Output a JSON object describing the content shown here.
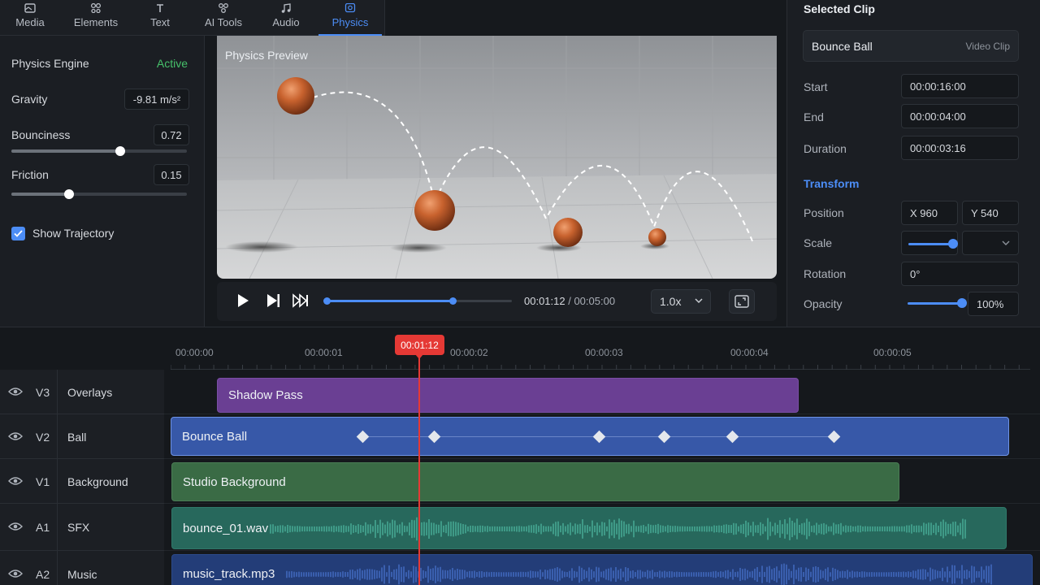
{
  "tabs": [
    {
      "label": "Media",
      "icon": "media-icon"
    },
    {
      "label": "Elements",
      "icon": "elements-icon"
    },
    {
      "label": "Text",
      "icon": "text-icon"
    },
    {
      "label": "AI Tools",
      "icon": "ai-tools-icon"
    },
    {
      "label": "Audio",
      "icon": "audio-icon"
    },
    {
      "label": "Physics",
      "icon": "physics-icon",
      "active": true
    }
  ],
  "physics": {
    "engine_label": "Physics Engine",
    "engine_status": "Active",
    "gravity_label": "Gravity",
    "gravity_value": "-9.81 m/s²",
    "bounciness_label": "Bounciness",
    "bounciness_value": "0.72",
    "bounciness": 0.62,
    "friction_label": "Friction",
    "friction_value": "0.15",
    "friction": 0.33,
    "show_trajectory_label": "Show Trajectory",
    "show_trajectory": true
  },
  "preview": {
    "label": "Physics Preview",
    "current_time": "00:01:12",
    "separator": " / ",
    "total_time": "00:05:00",
    "progress": 0.68,
    "speed": "1.0x"
  },
  "selected_clip": {
    "heading": "Selected Clip",
    "name": "Bounce Ball",
    "type": "Video Clip",
    "start_label": "Start",
    "start": "00:00:16:00",
    "end_label": "End",
    "end": "00:00:04:00",
    "duration_label": "Duration",
    "duration": "00:00:03:16",
    "transform_heading": "Transform",
    "position_label": "Position",
    "position_x": "X 960",
    "position_y": "Y 540",
    "scale_label": "Scale",
    "rotation_label": "Rotation",
    "rotation": "0°",
    "opacity_label": "Opacity",
    "opacity": "100%"
  },
  "timeline": {
    "ruler": [
      "00:00:00",
      "00:00:01",
      "00:00:02",
      "00:00:03",
      "00:00:04",
      "00:00:05"
    ],
    "playhead": "00:01:12",
    "tracks": [
      {
        "id": "V3",
        "name": "Overlays",
        "clip": "Shadow Pass"
      },
      {
        "id": "V2",
        "name": "Ball",
        "clip": "Bounce Ball"
      },
      {
        "id": "V1",
        "name": "Background",
        "clip": "Studio Background"
      },
      {
        "id": "A1",
        "name": "SFX",
        "clip": "bounce_01.wav"
      },
      {
        "id": "A2",
        "name": "Music",
        "clip": "music_track.mp3"
      }
    ]
  },
  "colors": {
    "accent": "#4c8df6",
    "active_status": "#46c06a",
    "playhead": "#e53935",
    "overlay_clip": "#6a3f93",
    "ball_clip": "#3758a8",
    "background_clip": "#3a6b45",
    "sfx_clip": "#27685c",
    "music_clip": "#233d78"
  }
}
